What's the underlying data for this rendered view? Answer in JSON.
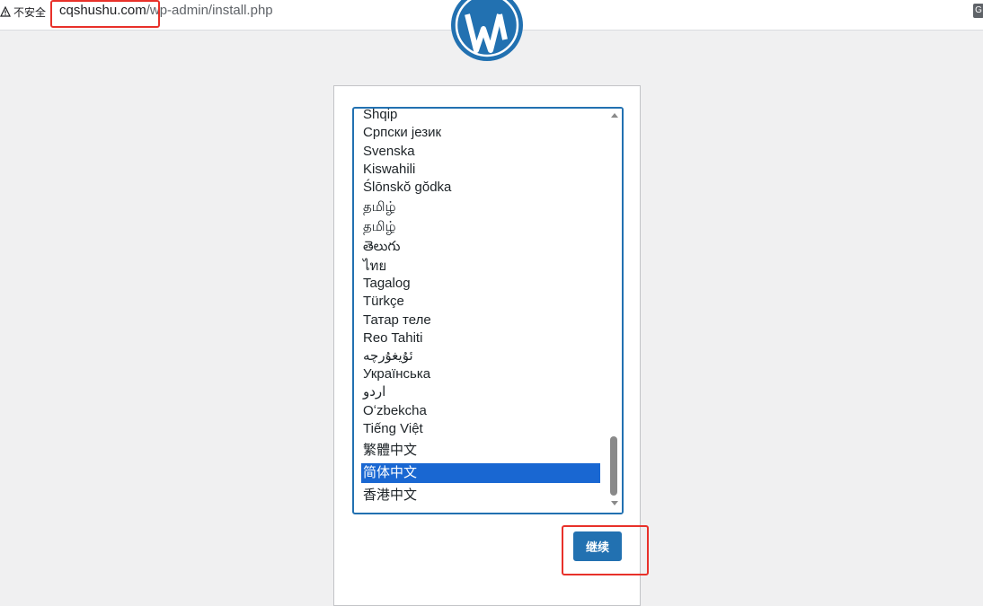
{
  "browser": {
    "security_label": "不安全",
    "url_host": "cqshushu.com",
    "url_path": "/wp-admin/install.php",
    "translate_icon": "translate-icon",
    "warning_icon": "warning-triangle-icon"
  },
  "installer": {
    "logo_icon": "wordpress-logo-icon",
    "languages": [
      "Shqip",
      "Српски језик",
      "Svenska",
      "Kiswahili",
      "Ślōnskŏ gŏdka",
      "தமிழ்",
      "தமிழ்",
      "తెలుగు",
      "ไทย",
      "Tagalog",
      "Türkçe",
      "Татар теле",
      "Reo Tahiti",
      "ئۇيغۇرچە",
      "Українська",
      "اردو",
      "Oʻzbekcha",
      "Tiếng Việt",
      "繁體中文",
      "简体中文",
      "香港中文"
    ],
    "selected_language": "简体中文",
    "continue_label": "继续"
  },
  "colors": {
    "accent": "#2271b1",
    "selection": "#1967d2",
    "annotation": "#e8312a"
  }
}
